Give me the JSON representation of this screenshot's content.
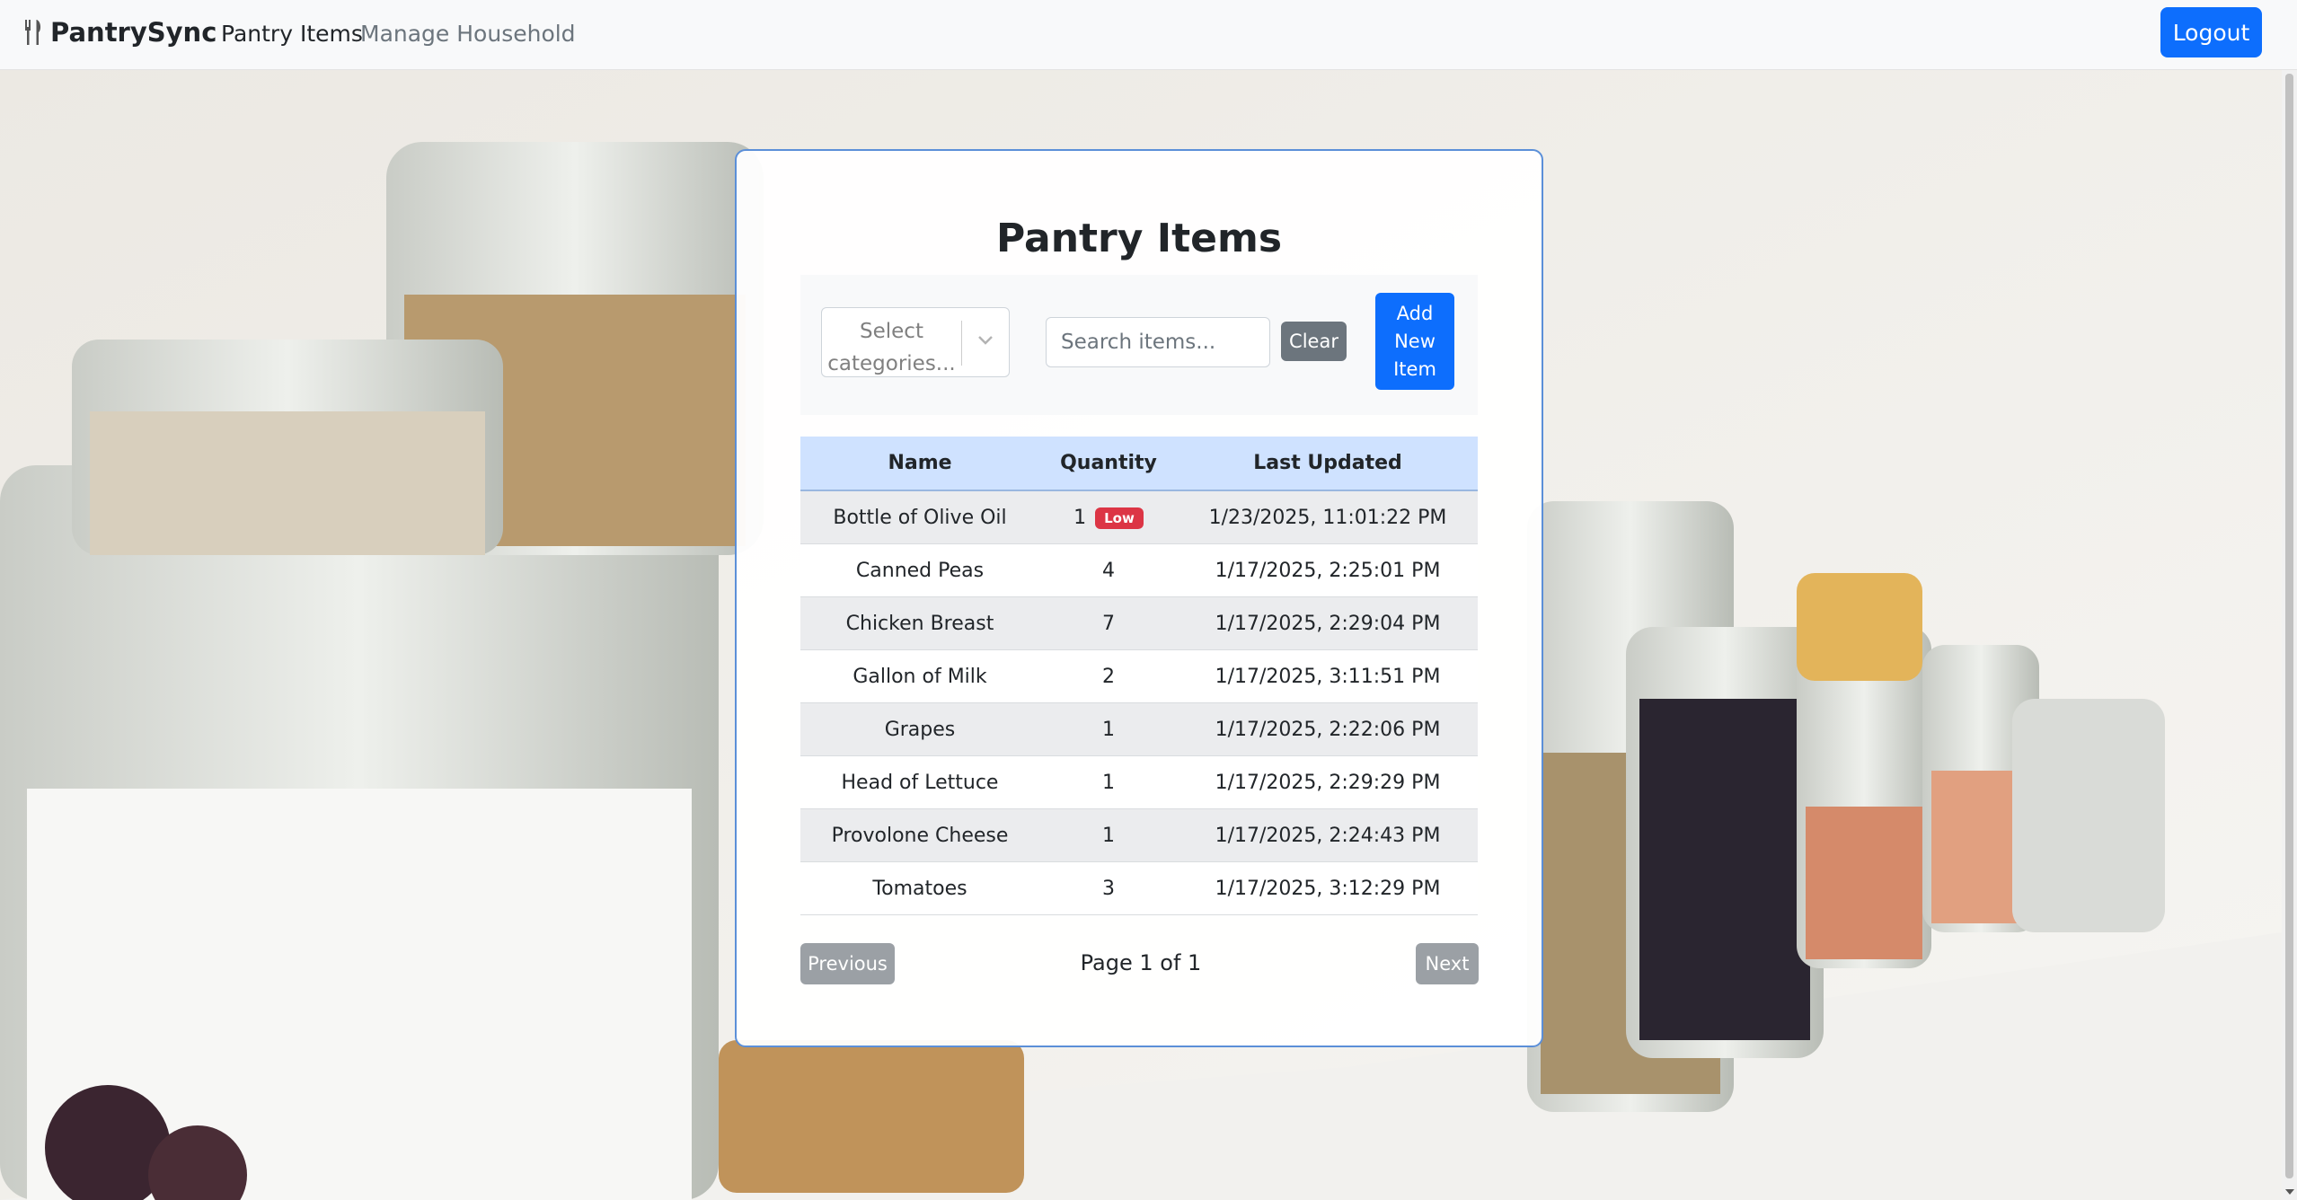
{
  "navbar": {
    "brand": "PantrySync",
    "brand_icon": "utensils-icon",
    "links": [
      "Pantry Items",
      "Manage Household"
    ],
    "logout_label": "Logout"
  },
  "card": {
    "title": "Pantry Items",
    "category_placeholder": "Select categories...",
    "search_placeholder": "Search items...",
    "clear_label": "Clear",
    "add_label": "Add New Item"
  },
  "table": {
    "headers": [
      "Name",
      "Quantity",
      "Last Updated"
    ],
    "rows": [
      {
        "name": "Bottle of Olive Oil",
        "quantity": "1",
        "badge": "Low",
        "updated": "1/23/2025, 11:01:22 PM"
      },
      {
        "name": "Canned Peas",
        "quantity": "4",
        "badge": "",
        "updated": "1/17/2025, 2:25:01 PM"
      },
      {
        "name": "Chicken Breast",
        "quantity": "7",
        "badge": "",
        "updated": "1/17/2025, 2:29:04 PM"
      },
      {
        "name": "Gallon of Milk",
        "quantity": "2",
        "badge": "",
        "updated": "1/17/2025, 3:11:51 PM"
      },
      {
        "name": "Grapes",
        "quantity": "1",
        "badge": "",
        "updated": "1/17/2025, 2:22:06 PM"
      },
      {
        "name": "Head of Lettuce",
        "quantity": "1",
        "badge": "",
        "updated": "1/17/2025, 2:29:29 PM"
      },
      {
        "name": "Provolone Cheese",
        "quantity": "1",
        "badge": "",
        "updated": "1/17/2025, 2:24:43 PM"
      },
      {
        "name": "Tomatoes",
        "quantity": "3",
        "badge": "",
        "updated": "1/17/2025, 3:12:29 PM"
      }
    ]
  },
  "pagination": {
    "previous_label": "Previous",
    "page_info": "Page 1 of 1",
    "next_label": "Next"
  },
  "colors": {
    "primary": "#0d6efd",
    "secondary": "#6c757d",
    "danger": "#dc3545",
    "table_header": "#cfe2ff"
  }
}
